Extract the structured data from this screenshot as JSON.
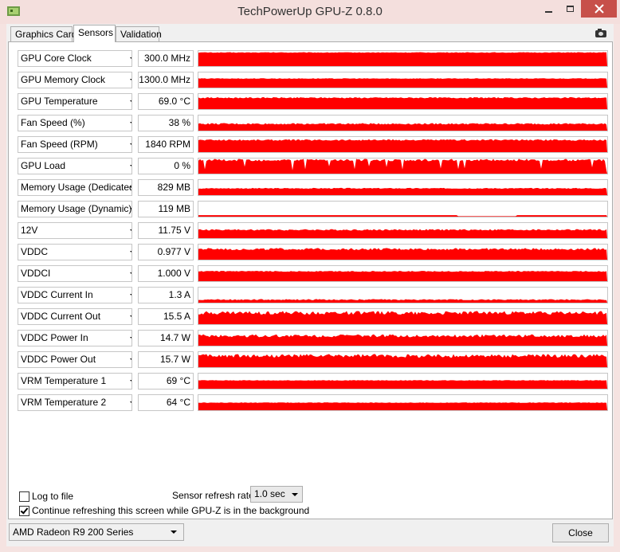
{
  "window": {
    "title": "TechPowerUp GPU-Z 0.8.0"
  },
  "tabs": [
    {
      "label": "Graphics Card",
      "active": false
    },
    {
      "label": "Sensors",
      "active": true
    },
    {
      "label": "Validation",
      "active": false
    }
  ],
  "sensors": [
    {
      "name": "GPU Core Clock",
      "value": "300.0 MHz",
      "level": 0.9,
      "noise": 0.02
    },
    {
      "name": "GPU Memory Clock",
      "value": "1300.0 MHz",
      "level": 0.6,
      "noise": 0.02
    },
    {
      "name": "GPU Temperature",
      "value": "69.0 °C",
      "level": 0.75,
      "noise": 0.04
    },
    {
      "name": "Fan Speed (%)",
      "value": "38 %",
      "level": 0.45,
      "noise": 0.05
    },
    {
      "name": "Fan Speed (RPM)",
      "value": "1840 RPM",
      "level": 0.8,
      "noise": 0.05
    },
    {
      "name": "GPU Load",
      "value": "0 %",
      "level": 0.9,
      "noise": 0.08,
      "spikes": true
    },
    {
      "name": "Memory Usage (Dedicated)",
      "value": "829 MB",
      "level": 0.45,
      "noise": 0.03
    },
    {
      "name": "Memory Usage (Dynamic)",
      "value": "119 MB",
      "level": 0.1,
      "noise": 0.0
    },
    {
      "name": "12V",
      "value": "11.75 V",
      "level": 0.55,
      "noise": 0.05
    },
    {
      "name": "VDDC",
      "value": "0.977 V",
      "level": 0.7,
      "noise": 0.07
    },
    {
      "name": "VDDCI",
      "value": "1.000 V",
      "level": 0.65,
      "noise": 0.03
    },
    {
      "name": "VDDC Current In",
      "value": "1.3 A",
      "level": 0.2,
      "noise": 0.04
    },
    {
      "name": "VDDC Current Out",
      "value": "15.5 A",
      "level": 0.75,
      "noise": 0.12
    },
    {
      "name": "VDDC Power In",
      "value": "14.7 W",
      "level": 0.65,
      "noise": 0.1
    },
    {
      "name": "VDDC Power Out",
      "value": "15.7 W",
      "level": 0.75,
      "noise": 0.12
    },
    {
      "name": "VRM Temperature 1",
      "value": "69 °C",
      "level": 0.55,
      "noise": 0.02
    },
    {
      "name": "VRM Temperature 2",
      "value": "64 °C",
      "level": 0.5,
      "noise": 0.02
    }
  ],
  "options": {
    "log_to_file": {
      "label": "Log to file",
      "checked": false
    },
    "continue_refresh": {
      "label": "Continue refreshing this screen while GPU-Z is in the background",
      "checked": true
    },
    "refresh_rate_label": "Sensor refresh rate:",
    "refresh_rate_value": "1.0 sec"
  },
  "footer": {
    "gpu_select": "AMD Radeon R9 200 Series",
    "close_label": "Close"
  },
  "colors": {
    "graph": "#ff0000",
    "close_button": "#c7504a"
  }
}
